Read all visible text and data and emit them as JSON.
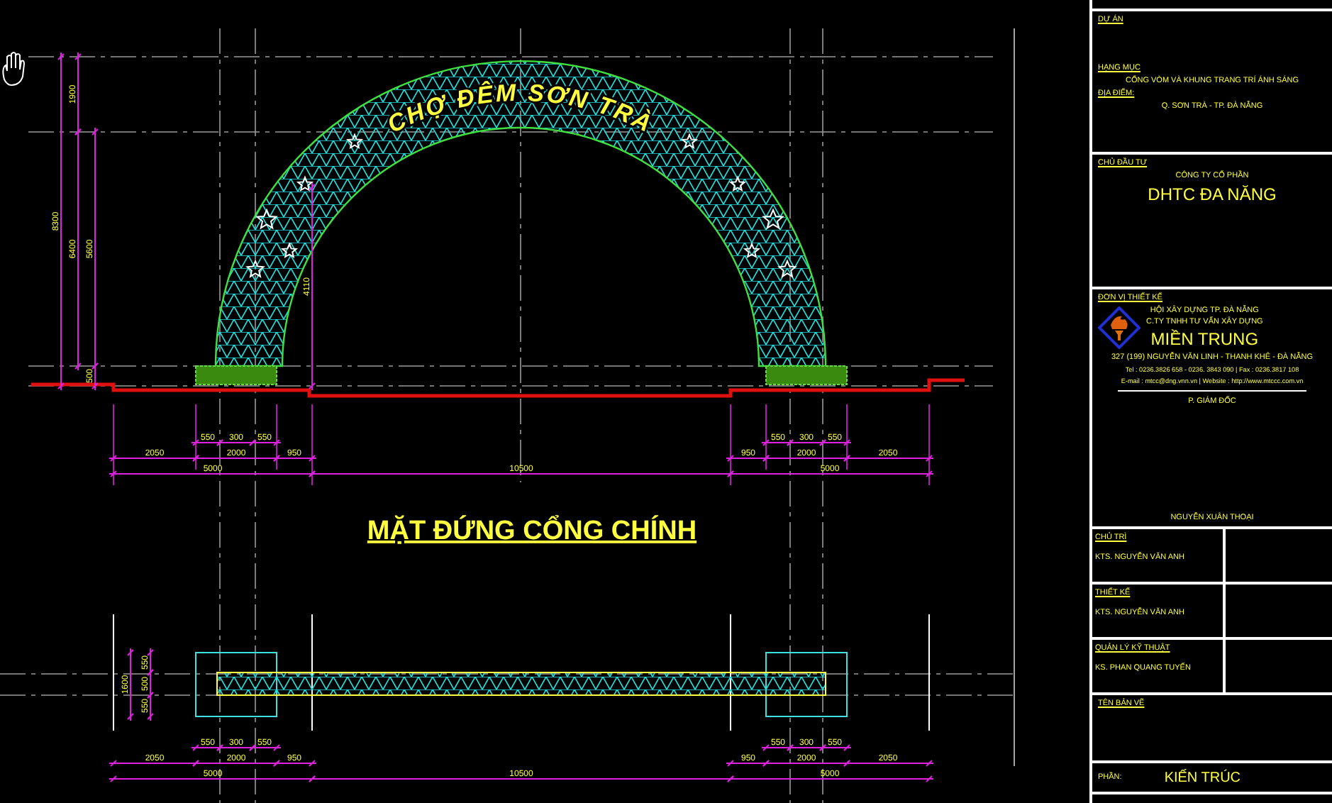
{
  "elevation": {
    "sign_text": "CHỢ ĐÊM SƠN TRÀ",
    "title": "MẶT ĐỨNG CỔNG CHÍNH",
    "height_dims": [
      "1900",
      "8300",
      "6400",
      "5600",
      "500",
      "4110"
    ],
    "left_dims": {
      "upper": [
        "550",
        "300",
        "550"
      ],
      "lower": [
        "2050",
        "2000",
        "950"
      ],
      "total": "5000"
    },
    "middle_total": "10500",
    "right_dims": {
      "upper": [
        "550",
        "300",
        "550"
      ],
      "lower": [
        "950",
        "2000",
        "2050"
      ],
      "total": "5000"
    }
  },
  "plan": {
    "width_dims": [
      "1600",
      "550",
      "500",
      "550"
    ],
    "left_dims": {
      "upper": [
        "550",
        "300",
        "550"
      ],
      "lower": [
        "2050",
        "2000",
        "950"
      ],
      "total": "5000"
    },
    "middle_total": "10500",
    "right_dims": {
      "upper": [
        "550",
        "300",
        "550"
      ],
      "lower": [
        "950",
        "2000",
        "2050"
      ],
      "total": "5000"
    }
  },
  "title_block": {
    "project": {
      "label": "DỰ ÁN"
    },
    "category": {
      "label": "HẠNG MỤC",
      "value": "CỔNG VÒM VÀ KHUNG TRANG TRÍ ÁNH SÁNG"
    },
    "location": {
      "label": "ĐỊA ĐIỂM:",
      "value": "Q. SƠN TRÀ - TP. ĐÀ NẴNG"
    },
    "client": {
      "label": "CHỦ ĐẦU TƯ",
      "lines": [
        "CÔNG TY CỔ PHẦN",
        "DHTC ĐA NĂNG"
      ]
    },
    "designer": {
      "label": "ĐƠN VỊ THIẾT KẾ",
      "org_lines": [
        "HỘI XÂY DỰNG TP. ĐÀ NẴNG",
        "C.TY TNHH TƯ VẤN XÂY DỰNG"
      ],
      "org_name": "MIỀN TRUNG",
      "address": "327 (199) NGUYỄN VĂN LINH - THANH KHÊ - ĐÀ NẴNG",
      "contact": [
        "Tel : 0236.3826 658 - 0236. 3843 090 | Fax : 0236.3817 108",
        "E-mail : mtcc@dng.vnn.vn | Website : http://www.mtccc.com.vn"
      ],
      "signer_role": "P. GIÁM ĐỐC",
      "signer_name": "NGUYỄN XUÂN THOẠI"
    },
    "staff": [
      {
        "role": "CHỦ TRÌ",
        "name": "KTS. NGUYỄN VĂN ANH"
      },
      {
        "role": "THIẾT KẾ",
        "name": "KTS. NGUYỄN VĂN ANH"
      },
      {
        "role": "QUẢN LÝ KỸ THUẬT",
        "name": "KS. PHAN QUANG TUYẾN"
      }
    ],
    "drawing_name": {
      "label": "TÊN BẢN VẼ"
    },
    "section": {
      "label": "PHẦN:",
      "value": "KIẾN TRÚC"
    }
  }
}
